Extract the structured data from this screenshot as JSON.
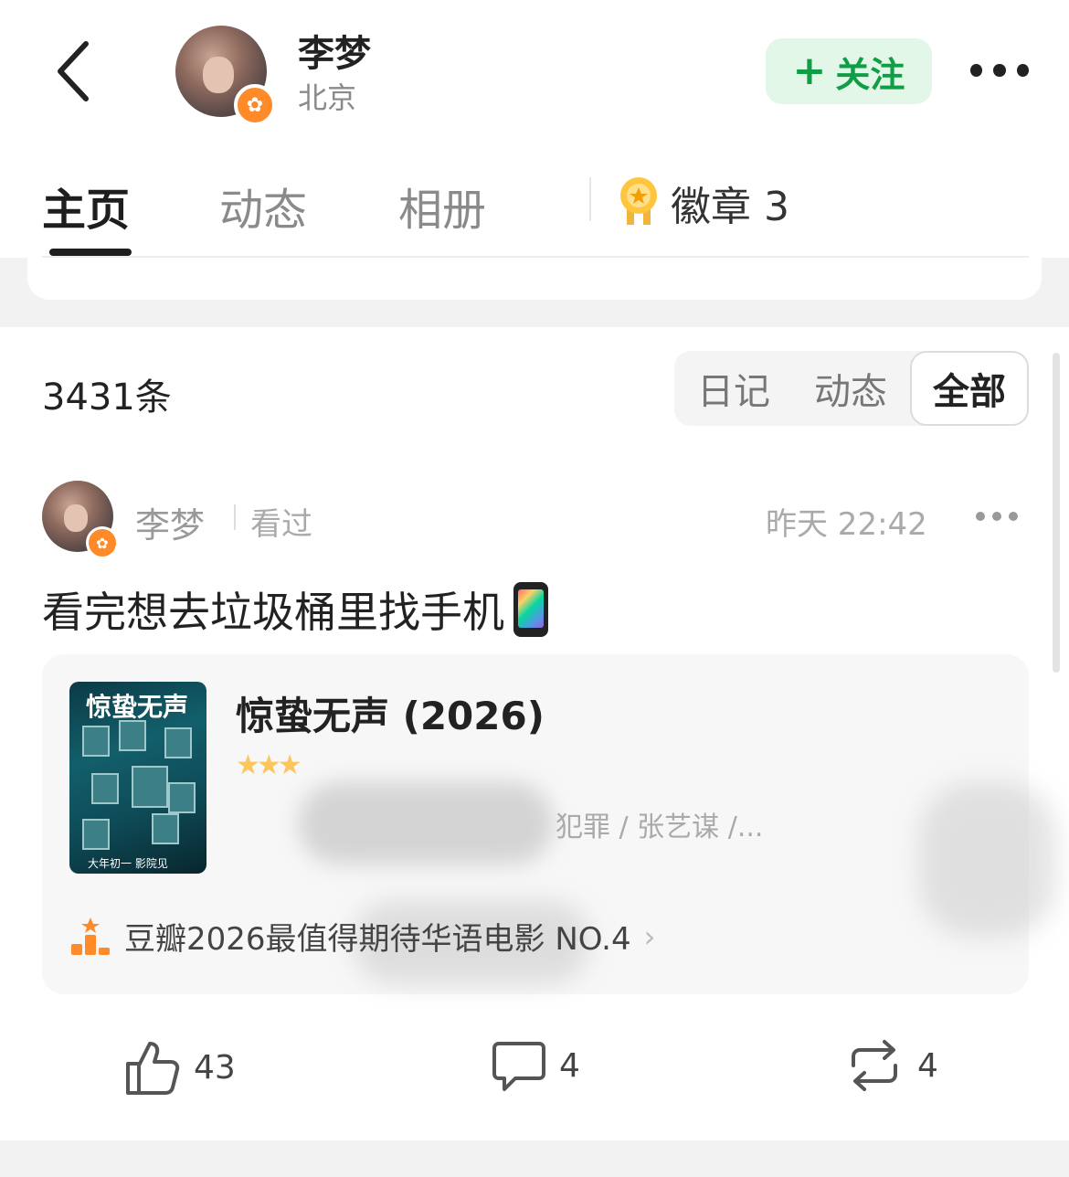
{
  "header": {
    "user_name": "李梦",
    "location": "北京",
    "follow_label": "关注"
  },
  "tabs": [
    {
      "label": "主页",
      "active": true
    },
    {
      "label": "动态",
      "active": false
    },
    {
      "label": "相册",
      "active": false
    }
  ],
  "badges_tab": {
    "label": "徽章",
    "count": "3"
  },
  "feed": {
    "count_label": "3431条",
    "filters": [
      {
        "label": "日记",
        "active": false
      },
      {
        "label": "动态",
        "active": false
      },
      {
        "label": "全部",
        "active": true
      }
    ]
  },
  "post": {
    "author": "李梦",
    "action": "看过",
    "time": "昨天 22:42",
    "text": "看完想去垃圾桶里找手机",
    "movie": {
      "title": "惊蛰无声 (2026)",
      "poster_title": "惊蛰无声",
      "poster_caption": "大年初一 影院见",
      "meta": "犯罪 / 张艺谋 /...",
      "rank_text": "豆瓣2026最值得期待华语电影 NO.4"
    },
    "likes": "43",
    "comments": "4",
    "reposts": "4"
  },
  "colors": {
    "accent_green": "#0f9e46",
    "follow_bg": "#e2f7e8",
    "badge_orange": "#ff8a2a"
  }
}
